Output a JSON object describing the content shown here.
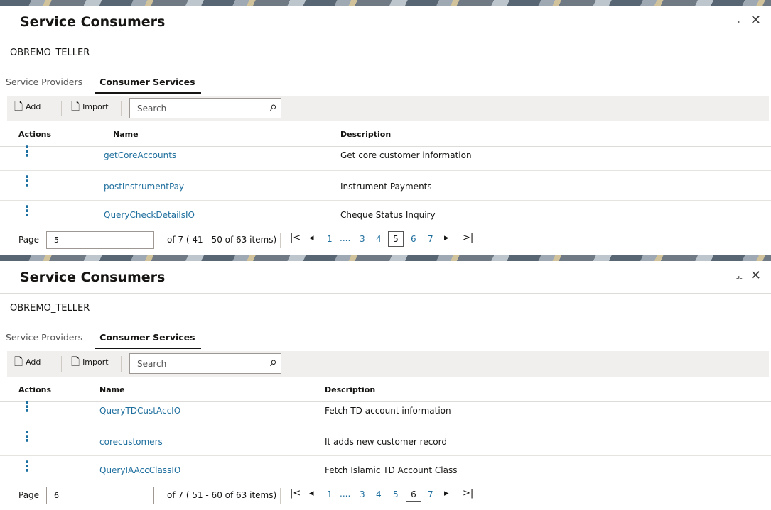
{
  "panels": [
    {
      "title": "Service Consumers",
      "user": "OBREMO_TELLER",
      "tabs": [
        "Service Providers",
        "Consumer Services"
      ],
      "toolbar": {
        "add": "Add",
        "import": "Import",
        "search_placeholder": "Search"
      },
      "columns": [
        "Actions",
        "Name",
        "Description"
      ],
      "rows": [
        {
          "name": "getCoreAccounts",
          "description": "Get core customer information"
        },
        {
          "name": "postInstrumentPay",
          "description": "Instrument Payments"
        },
        {
          "name": "QueryCheckDetailsIO",
          "description": "Cheque Status Inquiry"
        }
      ],
      "pager": {
        "label": "Page",
        "value": "5",
        "summary": "of 7   ( 41 - 50 of 63 items)",
        "first": "|<",
        "prev": "◂",
        "next": "▸",
        "last": ">|",
        "pages": [
          "1",
          "....",
          "3",
          "4",
          "5",
          "6",
          "7"
        ],
        "current": "5"
      }
    },
    {
      "title": "Service Consumers",
      "user": "OBREMO_TELLER",
      "tabs": [
        "Service Providers",
        "Consumer Services"
      ],
      "toolbar": {
        "add": "Add",
        "import": "Import",
        "search_placeholder": "Search"
      },
      "columns": [
        "Actions",
        "Name",
        "Description"
      ],
      "rows": [
        {
          "name": "QueryTDCustAccIO",
          "description": "Fetch TD account information"
        },
        {
          "name": "corecustomers",
          "description": "It adds new customer record"
        },
        {
          "name": "QueryIAAccClassIO",
          "description": "Fetch Islamic TD Account Class"
        }
      ],
      "pager": {
        "label": "Page",
        "value": "6",
        "summary": "of 7   ( 51 - 60 of 63 items)",
        "first": "|<",
        "prev": "◂",
        "next": "▸",
        "last": ">|",
        "pages": [
          "1",
          "....",
          "3",
          "4",
          "5",
          "6",
          "7"
        ],
        "current": "6"
      }
    }
  ],
  "icons": {
    "restore": "restore-icon",
    "close": "close-icon",
    "add": "add-file-icon",
    "import": "import-file-icon",
    "search": "search-icon",
    "actions": "kebab-menu-icon"
  },
  "colors": {
    "link": "#1f6f9e",
    "toolbar_bg": "#f1efed",
    "kebab": "#1b6ea0"
  }
}
